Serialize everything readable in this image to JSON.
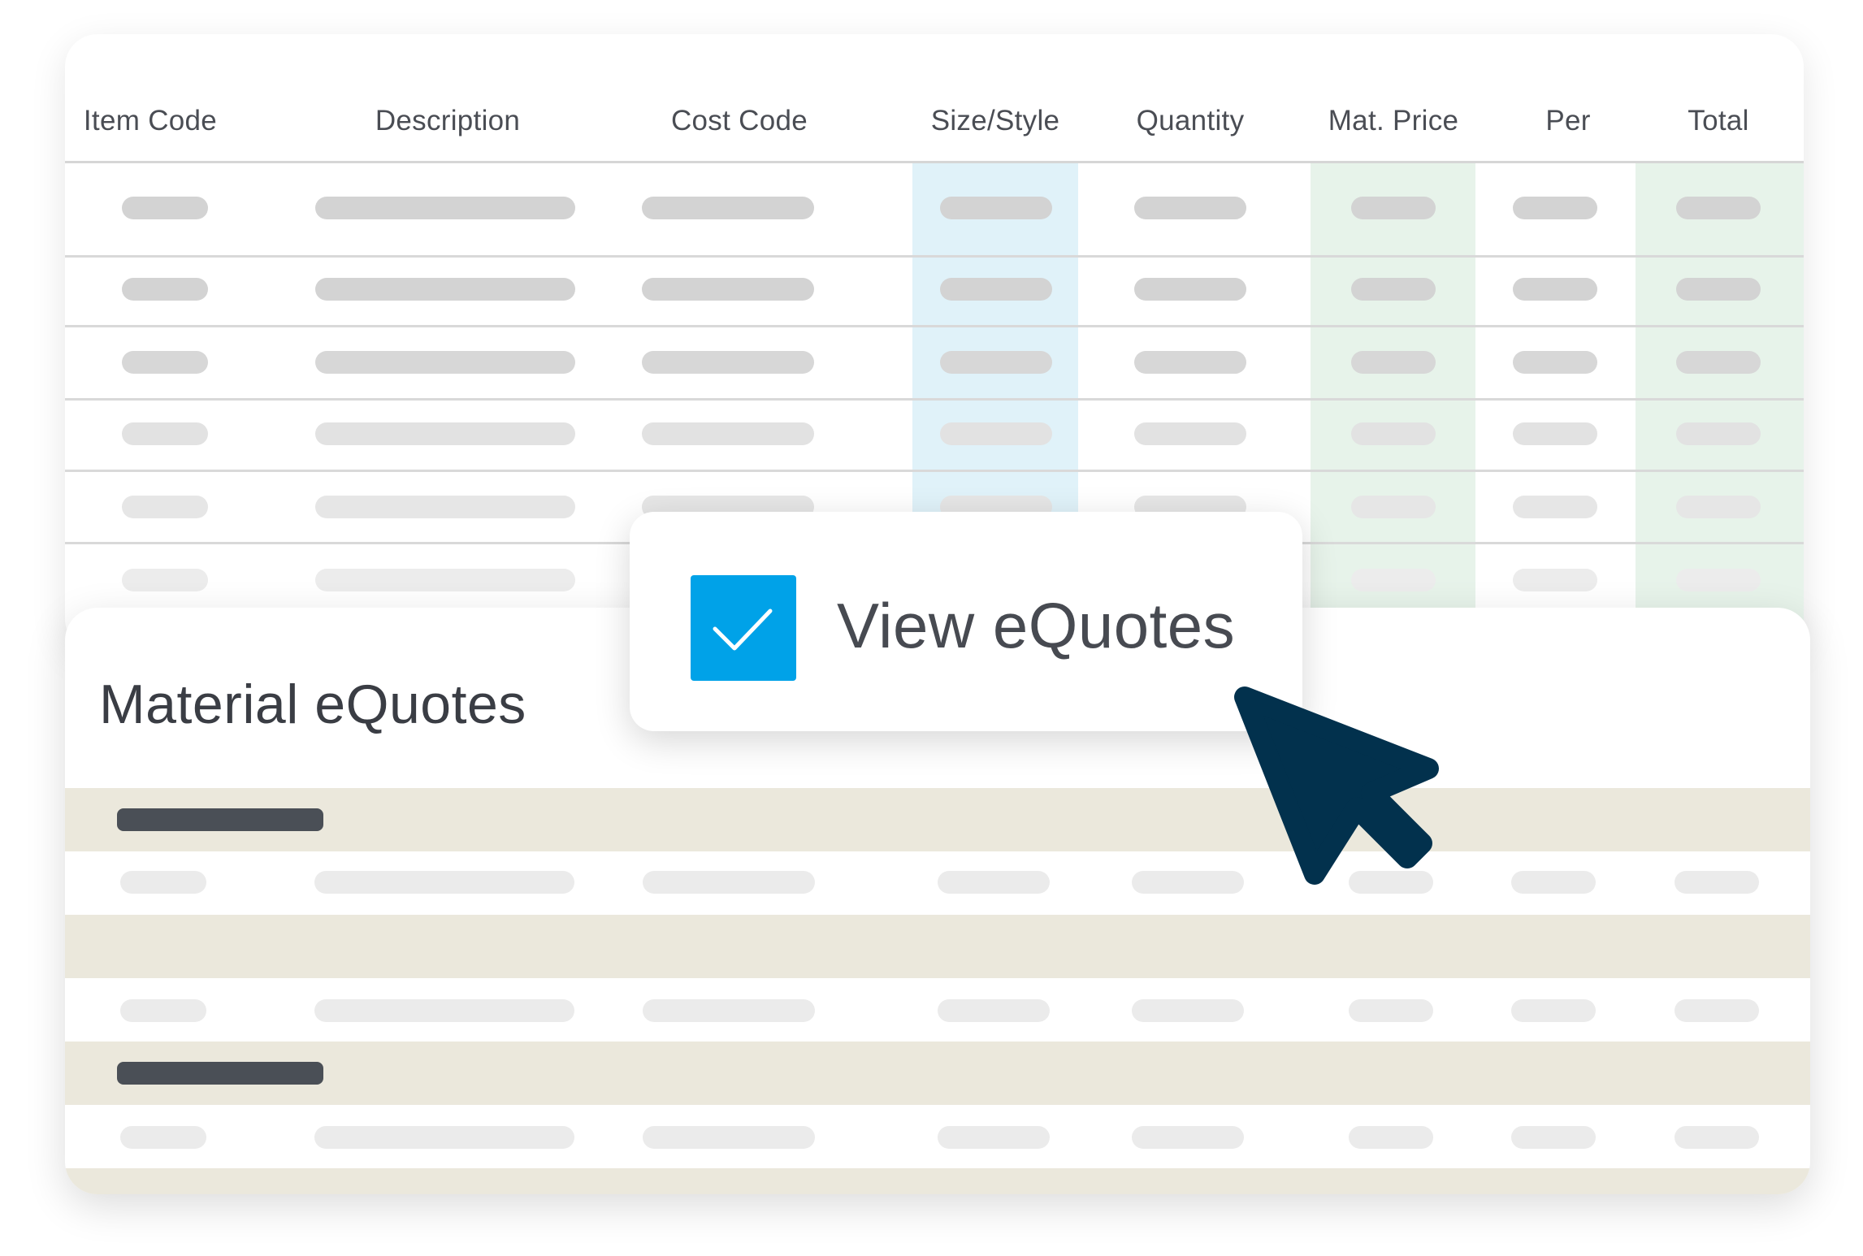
{
  "table": {
    "columns": [
      {
        "label": "Item Code"
      },
      {
        "label": "Description"
      },
      {
        "label": "Cost Code"
      },
      {
        "label": "Size/Style"
      },
      {
        "label": "Quantity"
      },
      {
        "label": "Mat. Price"
      },
      {
        "label": "Per"
      },
      {
        "label": "Total"
      }
    ],
    "highlighted_columns": {
      "Size/Style": "#e0f2f9",
      "Mat. Price": "#e7f3ea",
      "Total": "#e7f3ea"
    }
  },
  "popup": {
    "label": "View eQuotes",
    "checked": true
  },
  "section": {
    "title": "Material eQuotes"
  },
  "icons": [
    "checkmark-icon",
    "mouse-pointer-icon"
  ],
  "colors": {
    "checkbox": "#00a2e8",
    "cursor": "#02314d",
    "band": "#ebe8dc",
    "text": "#4a4d54"
  }
}
